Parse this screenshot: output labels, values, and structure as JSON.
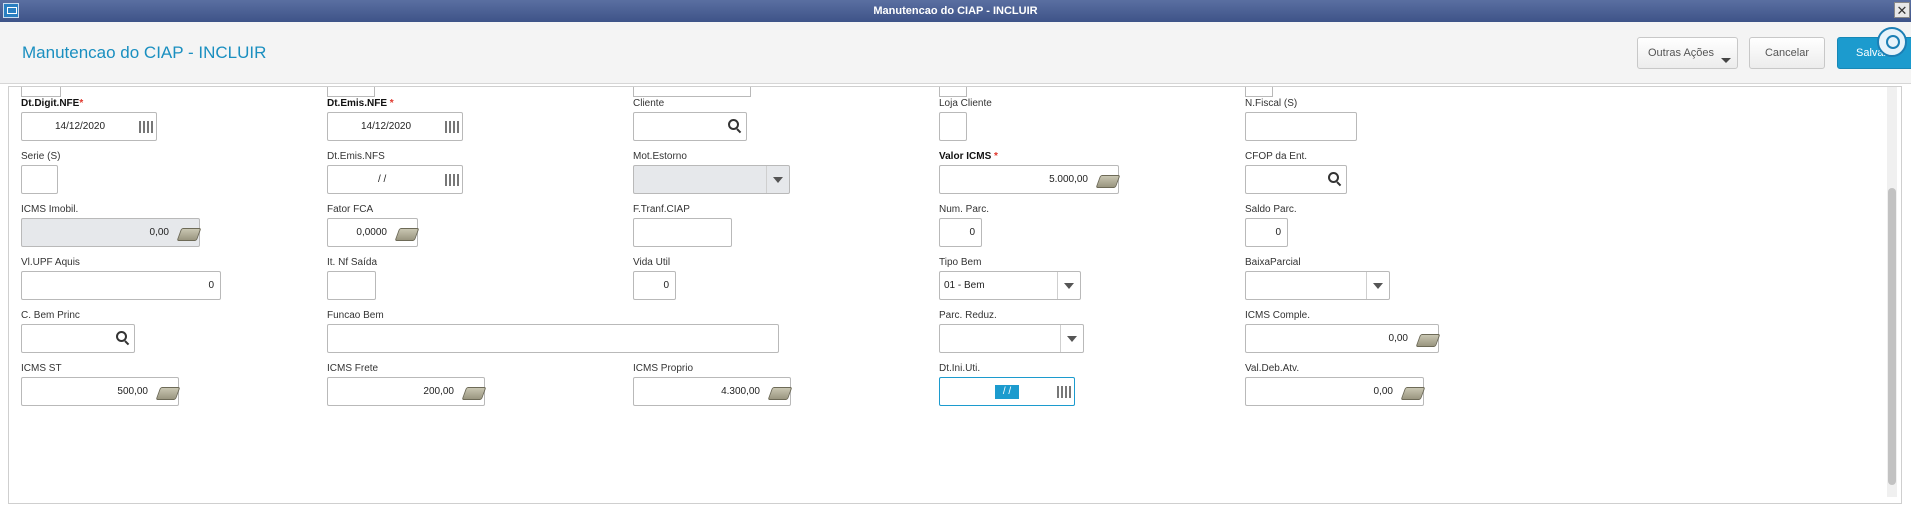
{
  "window": {
    "title": "Manutencao do CIAP - INCLUIR",
    "close_label": "✕"
  },
  "header": {
    "title": "Manutencao do CIAP - INCLUIR"
  },
  "toolbar": {
    "outras_label": "Outras Ações",
    "cancel_label": "Cancelar",
    "save_label": "Salvar"
  },
  "fields": {
    "dt_digit_nfe": {
      "label": "Dt.Digit.NFE",
      "value": "14/12/2020"
    },
    "dt_emis_nfe": {
      "label": "Dt.Emis.NFE ",
      "value": "14/12/2020"
    },
    "cliente": {
      "label": "Cliente",
      "value": ""
    },
    "loja_cliente": {
      "label": "Loja Cliente",
      "value": ""
    },
    "n_fiscal_s": {
      "label": "N.Fiscal (S)",
      "value": ""
    },
    "serie_s": {
      "label": "Serie (S)",
      "value": ""
    },
    "dt_emis_nfs": {
      "label": "Dt.Emis.NFS",
      "value": "/ /"
    },
    "mot_estorno": {
      "label": "Mot.Estorno",
      "value": ""
    },
    "valor_icms": {
      "label": "Valor ICMS ",
      "value": "5.000,00"
    },
    "cfop_ent": {
      "label": "CFOP da Ent.",
      "value": ""
    },
    "icms_imobil": {
      "label": "ICMS Imobil.",
      "value": "0,00"
    },
    "fator_fca": {
      "label": "Fator FCA",
      "value": "0,0000"
    },
    "f_tranf_ciap": {
      "label": "F.Tranf.CIAP",
      "value": ""
    },
    "num_parc": {
      "label": "Num. Parc.",
      "value": "0"
    },
    "saldo_parc": {
      "label": "Saldo Parc.",
      "value": "0"
    },
    "vl_upf_aquis": {
      "label": "Vl.UPF Aquis",
      "value": "0"
    },
    "it_nf_saida": {
      "label": "It. Nf Saída",
      "value": ""
    },
    "vida_util": {
      "label": "Vida Util",
      "value": "0"
    },
    "tipo_bem": {
      "label": "Tipo Bem",
      "value": "01 - Bem"
    },
    "baixa_parcial": {
      "label": "BaixaParcial",
      "value": ""
    },
    "c_bem_princ": {
      "label": "C. Bem Princ",
      "value": ""
    },
    "funcao_bem": {
      "label": "Funcao Bem",
      "value": ""
    },
    "parc_reduz": {
      "label": "Parc. Reduz.",
      "value": ""
    },
    "icms_comple": {
      "label": "ICMS Comple.",
      "value": "0,00"
    },
    "icms_st": {
      "label": "ICMS ST",
      "value": "500,00"
    },
    "icms_frete": {
      "label": "ICMS Frete",
      "value": "200,00"
    },
    "icms_proprio": {
      "label": "ICMS Proprio",
      "value": "4.300,00"
    },
    "dt_ini_uti": {
      "label": "Dt.Ini.Uti.",
      "value": "/ /"
    },
    "val_deb_atv": {
      "label": "Val.Deb.Atv.",
      "value": "0,00"
    }
  },
  "required_mark": "*",
  "colors": {
    "accent": "#1c9bce",
    "title_bar": "#3e5388",
    "required": "#e0362b"
  }
}
